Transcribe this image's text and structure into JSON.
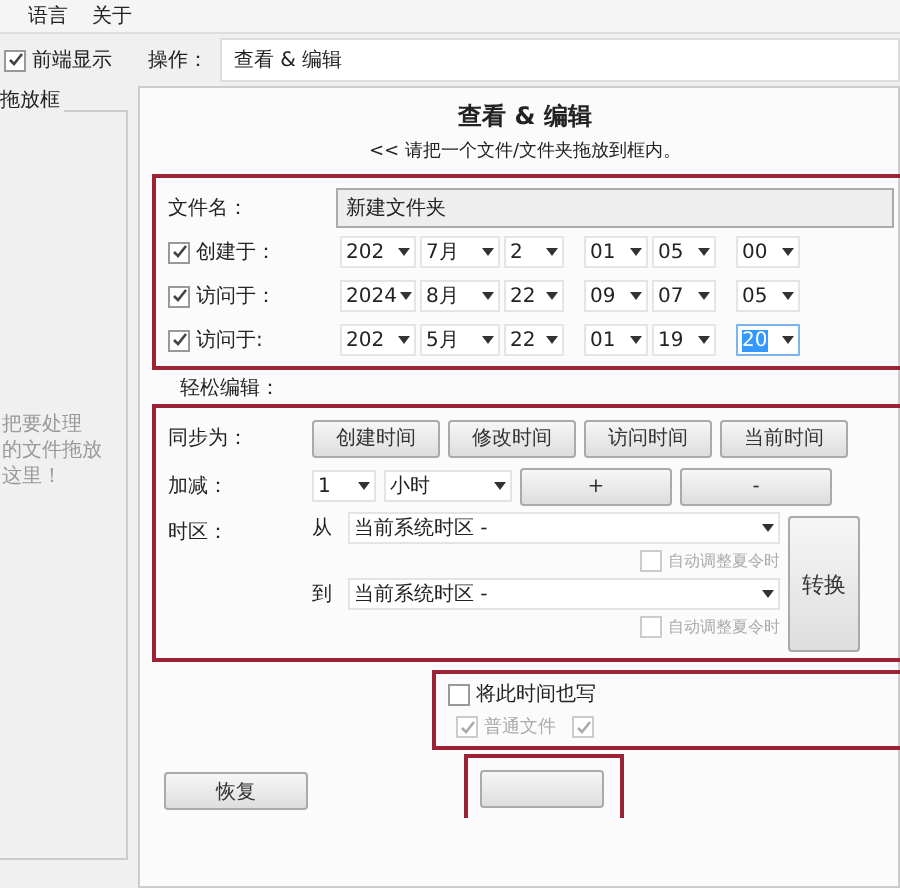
{
  "menu": [
    {
      "label": "语言"
    },
    {
      "label": "关于"
    }
  ],
  "topmost": {
    "label": "前端显示",
    "checked": true
  },
  "operation": {
    "label": "操作：",
    "value": "查看 & 编辑"
  },
  "drop_panel": {
    "title": "拖放框",
    "hint_lines": [
      "把要处理",
      "的文件拖放",
      "这里！"
    ]
  },
  "heading": "查看 & 编辑",
  "subtitle": "<< 请把一个文件/文件夹拖放到框内。",
  "file_name": {
    "label": "文件名：",
    "value": "新建文件夹"
  },
  "dates": [
    {
      "label": "创建于：",
      "checked": true,
      "year": "202",
      "month": "7月",
      "day": "2",
      "hour": "01",
      "minute": "05",
      "second": "00",
      "second_selected": false
    },
    {
      "label": "访问于：",
      "checked": true,
      "year": "2024",
      "month": "8月",
      "day": "22",
      "hour": "09",
      "minute": "07",
      "second": "05",
      "second_selected": false
    },
    {
      "label": "访问于:",
      "checked": true,
      "year": "202",
      "month": "5月",
      "day": "22",
      "hour": "01",
      "minute": "19",
      "second": "20",
      "second_selected": true
    }
  ],
  "easy_edit": {
    "title": "轻松编辑：",
    "sync_label": "同步为：",
    "sync_buttons": [
      "创建时间",
      "修改时间",
      "访问时间",
      "当前时间"
    ],
    "add_label": "加减：",
    "amount": "1",
    "unit": "小时",
    "plus": "+",
    "minus": "-",
    "tz_label": "时区：",
    "from_label": "从",
    "from_zone": "当前系统时区 -",
    "from_dst": {
      "label": "自动调整夏令时",
      "checked": false,
      "disabled": true
    },
    "to_label": "到",
    "to_zone": "当前系统时区 -",
    "to_dst": {
      "label": "自动调整夏令时",
      "checked": false,
      "disabled": true
    },
    "convert": "转换"
  },
  "write_also": {
    "label": "将此时间也写",
    "checked": false,
    "options": [
      {
        "label": "普通文件",
        "checked": true,
        "disabled": true
      },
      {
        "checked": true,
        "disabled": true
      }
    ]
  },
  "restore": "恢复"
}
